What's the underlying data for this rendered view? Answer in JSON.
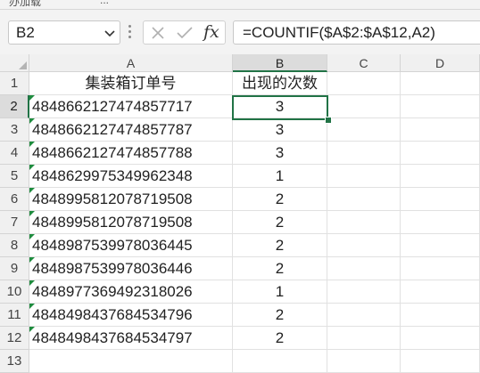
{
  "ribbon_fragment": [
    "办加载",
    "..."
  ],
  "name_box": {
    "value": "B2"
  },
  "formula": {
    "text": "=COUNTIF($A$2:$A$12,A2)",
    "fx_label": "fx"
  },
  "columns": [
    "A",
    "B",
    "C",
    "D"
  ],
  "rows": [
    "1",
    "2",
    "3",
    "4",
    "5",
    "6",
    "7",
    "8",
    "9",
    "10",
    "11",
    "12",
    "13"
  ],
  "header_row": {
    "a": "集装箱订单号",
    "b": "出现的次数"
  },
  "data_rows": [
    {
      "a": "4848662127474857717",
      "b": "3"
    },
    {
      "a": "4848662127474857787",
      "b": "3"
    },
    {
      "a": "4848662127474857788",
      "b": "3"
    },
    {
      "a": "4848629975349962348",
      "b": "1"
    },
    {
      "a": "4848995812078719508",
      "b": "2"
    },
    {
      "a": "4848995812078719508",
      "b": "2"
    },
    {
      "a": "4848987539978036445",
      "b": "2"
    },
    {
      "a": "4848987539978036446",
      "b": "2"
    },
    {
      "a": "4848977369492318026",
      "b": "1"
    },
    {
      "a": "4848498437684534796",
      "b": "2"
    },
    {
      "a": "4848498437684534797",
      "b": "2"
    }
  ],
  "colors": {
    "accent": "#217346",
    "error_flag": "#1e8c3e"
  }
}
